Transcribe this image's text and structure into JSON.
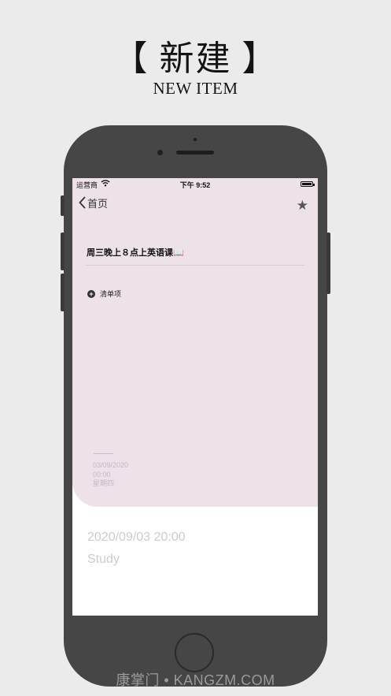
{
  "header": {
    "title": "【 新建 】",
    "subtitle": "NEW ITEM"
  },
  "status_bar": {
    "carrier": "运营商",
    "time": "下午 9:52"
  },
  "nav": {
    "back_label": "首页",
    "star_icon": "star-icon"
  },
  "task": {
    "title": "周三晚上８点上英语课📖"
  },
  "checklist": {
    "add_label": "清单项"
  },
  "faint_card": {
    "date": "03/09/2020",
    "time": "00:00",
    "weekday": "星期四"
  },
  "details": {
    "datetime": "2020/09/03 20:00",
    "category": "Study"
  },
  "watermark": "康掌门 • KANGZM.COM",
  "colors": {
    "background": "#ebebeb",
    "phone": "#464646",
    "pink": "#ede1ea"
  }
}
